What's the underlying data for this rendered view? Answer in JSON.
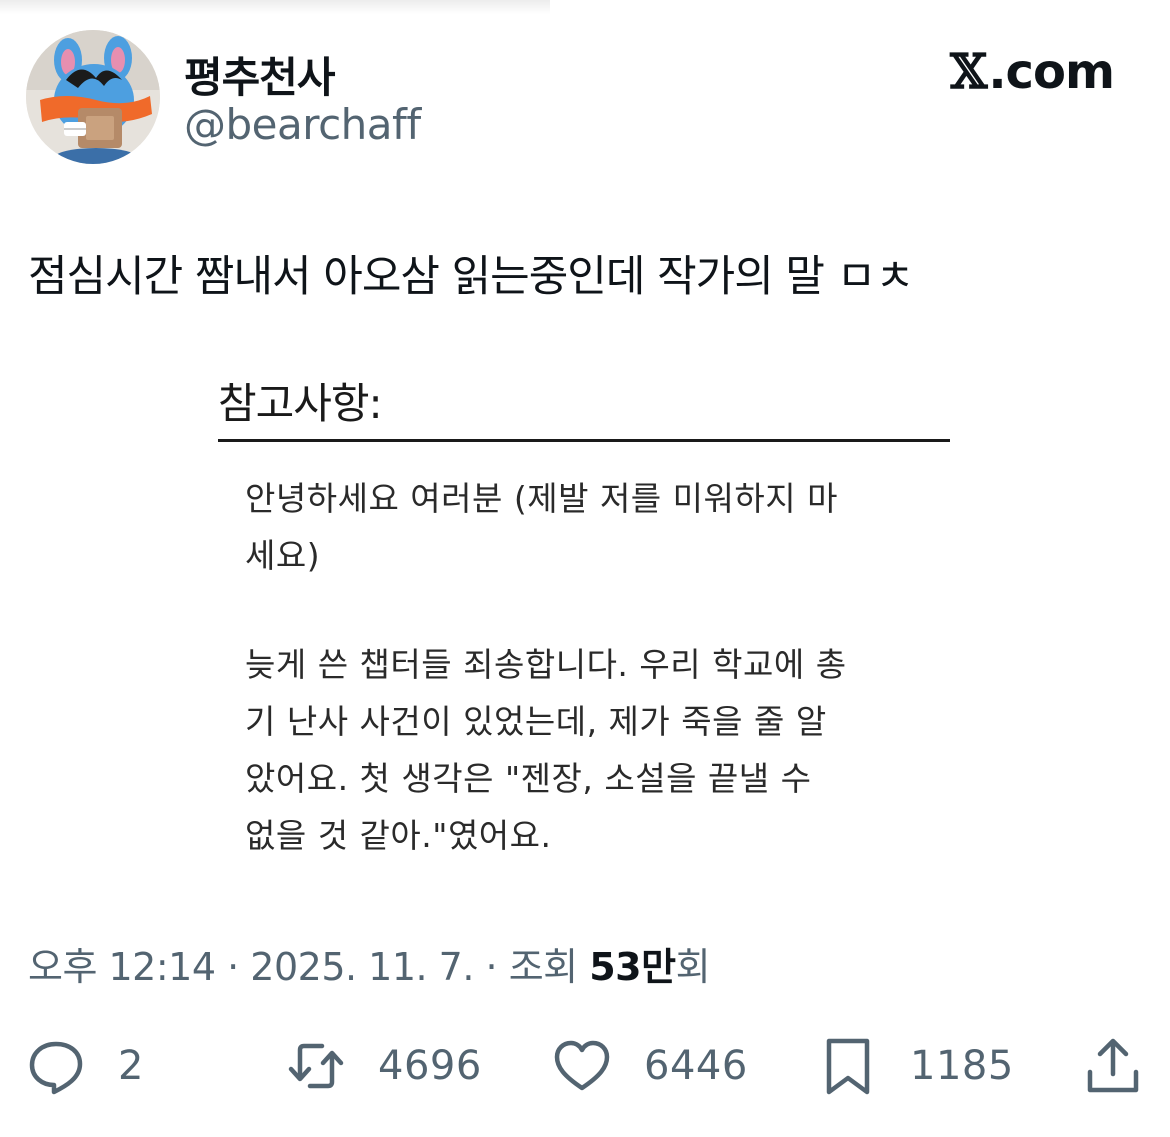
{
  "author": {
    "display_name": "평추천사",
    "handle": "@bearchaff"
  },
  "site_badge": {
    "glyph": "𝕏",
    "label": ".com"
  },
  "tweet": {
    "text": "점심시간 짬내서 아오삼 읽는중인데 작가의 말 ㅁㅊ"
  },
  "attached_note": {
    "title": "참고사항:",
    "paragraph_1": {
      "lines": [
        "안녕하세요 여러분 (제발 저를 미워하지 마",
        "세요)"
      ]
    },
    "paragraph_2": {
      "lines": [
        "늦게 쓴 챕터들 죄송합니다. 우리 학교에 총",
        "기 난사 사건이 있었는데, 제가 죽을 줄 알",
        "았어요. 첫 생각은 \"젠장, 소설을 끝낼 수",
        "없을 것 같아.\"였어요."
      ]
    }
  },
  "meta": {
    "time": "오후 12:14",
    "separator": "·",
    "date": "2025. 11. 7.",
    "views_label": "조회",
    "views_count": "53만",
    "views_suffix": "회"
  },
  "actions": {
    "reply": {
      "icon": "reply-icon",
      "count": "2"
    },
    "retweet": {
      "icon": "retweet-icon",
      "count": "4696"
    },
    "like": {
      "icon": "heart-icon",
      "count": "6446"
    },
    "bookmark": {
      "icon": "bookmark-icon",
      "count": "1185"
    },
    "share": {
      "icon": "share-icon"
    }
  },
  "colors": {
    "text_primary": "#0f1419",
    "text_secondary": "#536471",
    "avatar_accent_orange": "#f06a2a",
    "avatar_accent_blue": "#4d9fe0"
  }
}
